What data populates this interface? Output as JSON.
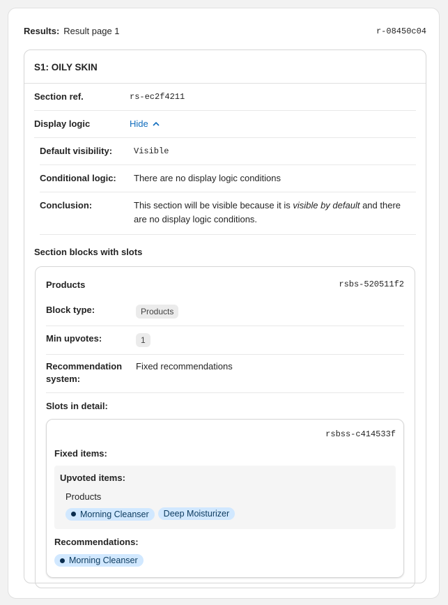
{
  "header": {
    "label": "Results:",
    "value": "Result page 1",
    "ref": "r-08450c04"
  },
  "section": {
    "title": "S1: OILY SKIN",
    "ref_label": "Section ref.",
    "ref": "rs-ec2f4211",
    "logic_label": "Display logic",
    "logic_toggle": "Hide",
    "default_label": "Default visibility:",
    "default": "Visible",
    "cond_label": "Conditional logic:",
    "cond": "There are no display logic conditions",
    "concl_label": "Conclusion:",
    "concl_pre": "This section will be visible because it is ",
    "concl_em": "visible by default",
    "concl_post": " and there are no display logic conditions.",
    "blocks_heading": "Section blocks with slots"
  },
  "block": {
    "title": "Products",
    "ref": "rsbs-520511f2",
    "type_label": "Block type:",
    "type": "Products",
    "min_label": "Min upvotes:",
    "min": "1",
    "rec_label": "Recommendation system:",
    "rec": "Fixed recommendations",
    "slots_label": "Slots in detail:"
  },
  "slot": {
    "ref": "rsbss-c414533f",
    "fixed_label": "Fixed items:",
    "upvoted_label": "Upvoted items:",
    "category": "Products",
    "upvoted": [
      "Morning Cleanser",
      "Deep Moisturizer"
    ],
    "rec_label": "Recommendations:",
    "recs": [
      "Morning Cleanser"
    ]
  }
}
